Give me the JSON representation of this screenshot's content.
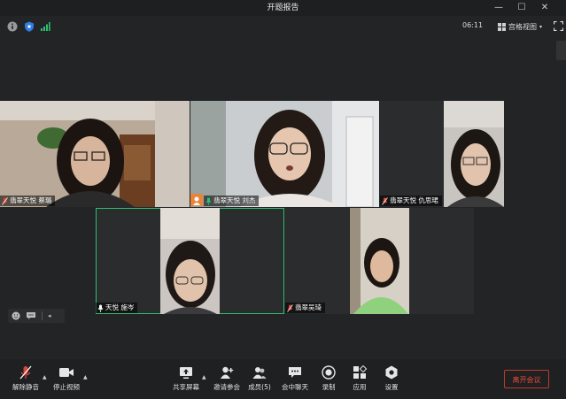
{
  "window": {
    "title": "开题报告",
    "controls": [
      "minimize",
      "maximize",
      "close"
    ]
  },
  "status": {
    "time": "06:11",
    "view_label": "宫格视图",
    "icons": [
      "info-icon",
      "shield-icon",
      "signal-icon"
    ]
  },
  "participants": [
    {
      "name": "翡翠天悦 蔡璐",
      "muted": true
    },
    {
      "name": "翡翠天悦 刘杰",
      "muted": false,
      "host_badge": true
    },
    {
      "name": "翡翠天悦 仇思珺",
      "muted": true
    },
    {
      "name": "天悦 施岑",
      "muted": false,
      "active_speaker": true
    },
    {
      "name": "翡翠吴琦",
      "muted": true
    },
    {
      "name": "",
      "muted": false
    }
  ],
  "toolbar": {
    "unmute": "解除静音",
    "stop_video": "停止视频",
    "share_screen": "共享屏幕",
    "invite": "邀请参会",
    "members": "成员(5)",
    "chat": "会中聊天",
    "record": "录制",
    "apps": "应用",
    "settings": "设置",
    "leave": "离开会议"
  },
  "colors": {
    "background": "#232426",
    "active_border": "#2fbf71",
    "leave_red": "#e74c3c",
    "muted_red": "#e0453a"
  }
}
